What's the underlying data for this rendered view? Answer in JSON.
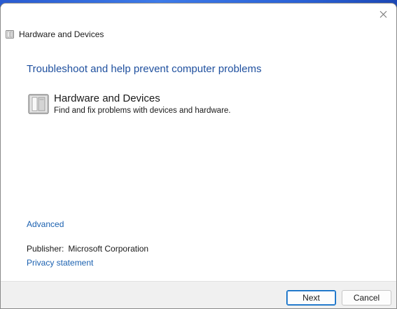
{
  "window": {
    "title": "Hardware and Devices",
    "close_icon": "close-icon"
  },
  "main": {
    "heading": "Troubleshoot and help prevent computer problems",
    "item": {
      "title": "Hardware and Devices",
      "description": "Find and fix problems with devices and hardware.",
      "icon": "hardware-device-icon"
    },
    "advanced_link": "Advanced",
    "publisher_label": "Publisher:",
    "publisher_value": "Microsoft Corporation",
    "privacy_link": "Privacy statement"
  },
  "footer": {
    "next_label": "Next",
    "cancel_label": "Cancel"
  },
  "colors": {
    "heading": "#1e4f9e",
    "link": "#1b61b0",
    "primary_border": "#0067c0",
    "footer_bg": "#f0f0f0"
  }
}
